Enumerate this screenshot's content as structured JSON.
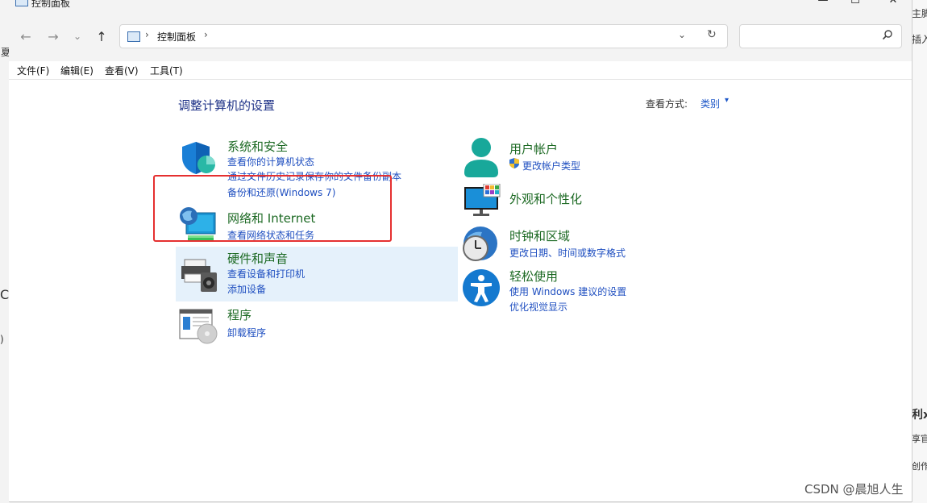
{
  "background": {
    "right_texts": [
      "主脚",
      "插入",
      "利x",
      "享官",
      "创作"
    ],
    "left_texts": [
      "夏",
      "C",
      ")"
    ]
  },
  "window": {
    "title": "控制面板",
    "controls": {
      "minimize": "—",
      "maximize": "☐",
      "close": "✕"
    }
  },
  "navbar": {
    "back": "←",
    "forward": "→",
    "recent": "⌄",
    "up": "↑",
    "address": {
      "separator": "›",
      "path": "控制面板",
      "trailing_separator": "›",
      "dropdown": "⌄",
      "refresh": "↻"
    },
    "search": {
      "placeholder": "",
      "icon": "search-icon"
    }
  },
  "menubar": {
    "items": [
      "文件(F)",
      "编辑(E)",
      "查看(V)",
      "工具(T)"
    ]
  },
  "main": {
    "heading": "调整计算机的设置",
    "view_by_label": "查看方式:",
    "view_by_value": "类别",
    "view_by_arrow": "▾",
    "categories_left": [
      {
        "title": "系统和安全",
        "links": [
          "查看你的计算机状态",
          "通过文件历史记录保存你的文件备份副本",
          "备份和还原(Windows 7)"
        ]
      },
      {
        "title": "网络和 Internet",
        "links": [
          "查看网络状态和任务"
        ]
      },
      {
        "title": "硬件和声音",
        "links": [
          "查看设备和打印机",
          "添加设备"
        ]
      },
      {
        "title": "程序",
        "links": [
          "卸载程序"
        ]
      }
    ],
    "categories_right": [
      {
        "title": "用户帐户",
        "links": [
          "更改帐户类型"
        ]
      },
      {
        "title": "外观和个性化",
        "links": []
      },
      {
        "title": "时钟和区域",
        "links": [
          "更改日期、时间或数字格式"
        ]
      },
      {
        "title": "轻松使用",
        "links": [
          "使用 Windows 建议的设置",
          "优化视觉显示"
        ]
      }
    ]
  },
  "watermark": "CSDN @晨旭人生",
  "colors": {
    "highlight_box": "#e53030",
    "hover": "#e5f1fb",
    "link": "#1f4fc0",
    "title": "#1d6a24"
  }
}
